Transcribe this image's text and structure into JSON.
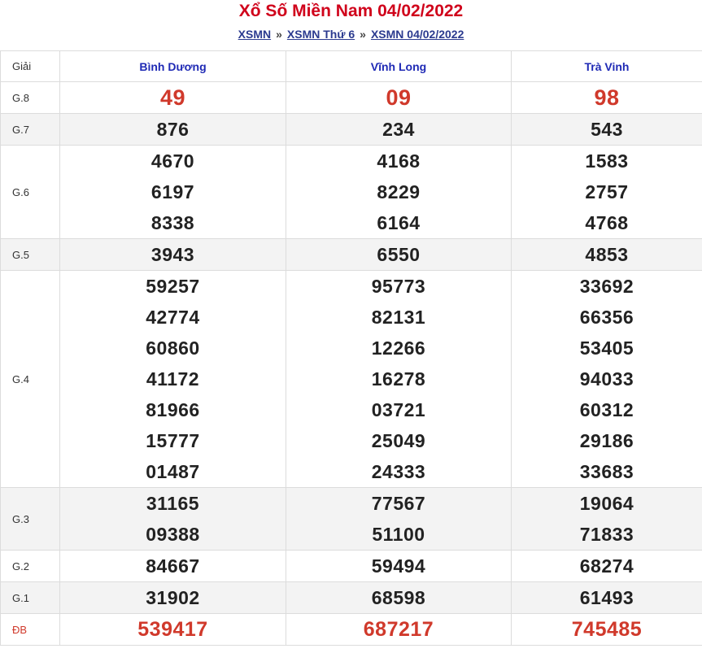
{
  "title": "Xổ Số Miền Nam 04/02/2022",
  "breadcrumb": {
    "items": [
      "XSMN",
      "XSMN Thứ 6",
      "XSMN 04/02/2022"
    ],
    "separator": "»"
  },
  "table": {
    "header": {
      "giai": "Giải",
      "provinces": [
        "Bình Dương",
        "Vĩnh Long",
        "Trà Vinh"
      ]
    },
    "rows": [
      {
        "label": "G.8",
        "cols": [
          [
            "49"
          ],
          [
            "09"
          ],
          [
            "98"
          ]
        ]
      },
      {
        "label": "G.7",
        "cols": [
          [
            "876"
          ],
          [
            "234"
          ],
          [
            "543"
          ]
        ]
      },
      {
        "label": "G.6",
        "cols": [
          [
            "4670",
            "6197",
            "8338"
          ],
          [
            "4168",
            "8229",
            "6164"
          ],
          [
            "1583",
            "2757",
            "4768"
          ]
        ]
      },
      {
        "label": "G.5",
        "cols": [
          [
            "3943"
          ],
          [
            "6550"
          ],
          [
            "4853"
          ]
        ]
      },
      {
        "label": "G.4",
        "cols": [
          [
            "59257",
            "42774",
            "60860",
            "41172",
            "81966",
            "15777",
            "01487"
          ],
          [
            "95773",
            "82131",
            "12266",
            "16278",
            "03721",
            "25049",
            "24333"
          ],
          [
            "33692",
            "66356",
            "53405",
            "94033",
            "60312",
            "29186",
            "33683"
          ]
        ]
      },
      {
        "label": "G.3",
        "cols": [
          [
            "31165",
            "09388"
          ],
          [
            "77567",
            "51100"
          ],
          [
            "19064",
            "71833"
          ]
        ]
      },
      {
        "label": "G.2",
        "cols": [
          [
            "84667"
          ],
          [
            "59494"
          ],
          [
            "68274"
          ]
        ]
      },
      {
        "label": "G.1",
        "cols": [
          [
            "31902"
          ],
          [
            "68598"
          ],
          [
            "61493"
          ]
        ]
      },
      {
        "label": "ĐB",
        "cols": [
          [
            "539417"
          ],
          [
            "687217"
          ],
          [
            "745485"
          ]
        ]
      }
    ]
  },
  "colors": {
    "title": "#d0021b",
    "province_header": "#1f2ab5",
    "special_numbers": "#d0392b",
    "row_shade": "#f3f3f3"
  }
}
